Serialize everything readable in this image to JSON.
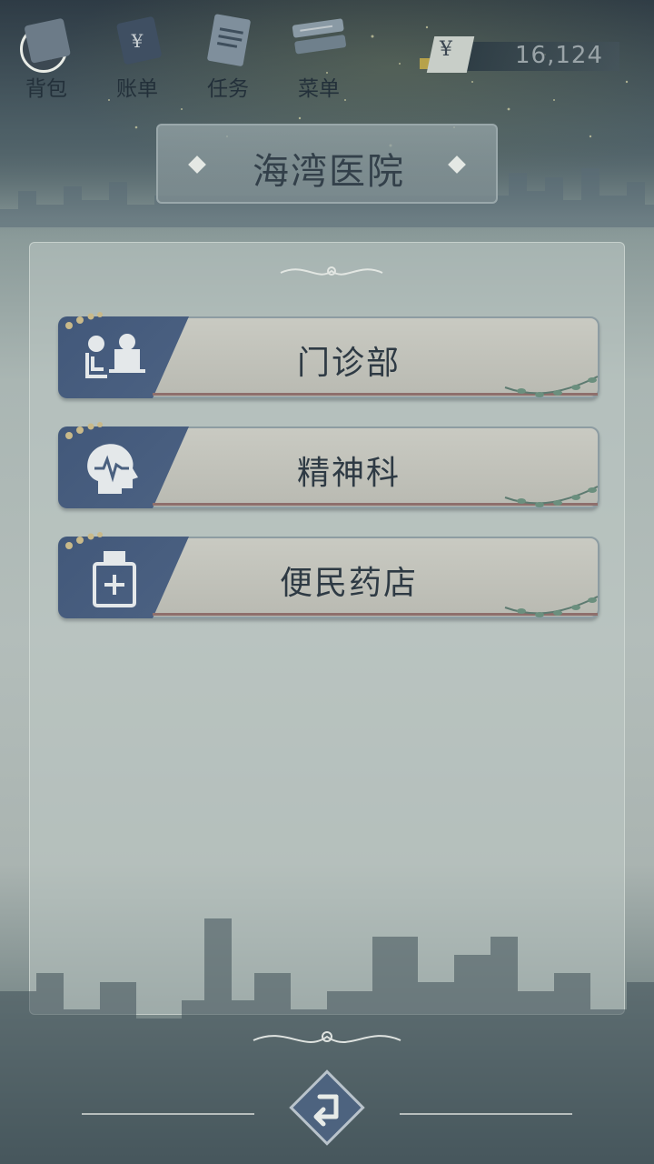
{
  "header": {
    "menu": [
      {
        "label": "背包",
        "icon": "bag-icon"
      },
      {
        "label": "账单",
        "icon": "bill-icon"
      },
      {
        "label": "任务",
        "icon": "task-icon"
      },
      {
        "label": "菜单",
        "icon": "menu-icon"
      }
    ],
    "currency": {
      "symbol": "¥",
      "value": "16,124"
    }
  },
  "title": "海湾医院",
  "departments": [
    {
      "label": "门诊部",
      "icon": "doctor-patient-icon"
    },
    {
      "label": "精神科",
      "icon": "head-pulse-icon"
    },
    {
      "label": "便民药店",
      "icon": "medicine-bottle-icon"
    }
  ],
  "footer": {
    "back_icon": "back-arrow-icon"
  },
  "colors": {
    "card_blue": "#4a607f",
    "card_beige": "#c4c5bd",
    "text_dark": "#2e3a44"
  }
}
